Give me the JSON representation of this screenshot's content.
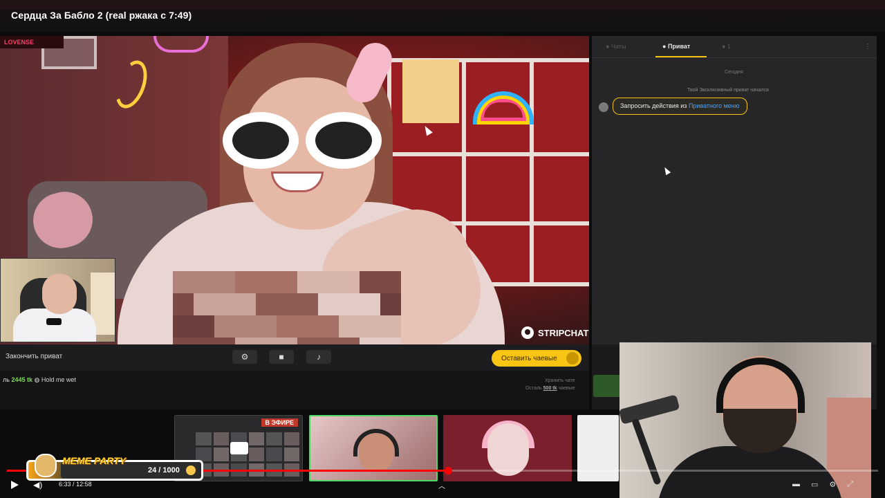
{
  "video": {
    "title": "Сердца За Бабло 2 (real ржака с 7:49)",
    "time_current": "6:33",
    "time_total": "12:58",
    "progress_fraction": 0.506
  },
  "stripchat": {
    "lovense_label": "LOVENSE",
    "watermark": "STRIPCHAT",
    "end_private_label": "Закончить приват",
    "tip_button_label": "Оставить чаевые",
    "tip_line": {
      "prefix": "ль",
      "amount": "2445 tk",
      "message": "Hold me wet"
    },
    "right_note_line1": "Хранить чате",
    "right_note_line2_prefix": "Осталь",
    "right_note_amount": "500 tk",
    "right_note_line2_suffix": "чаевые"
  },
  "chat": {
    "tab_left": "Чаты",
    "tab_active": "Приват",
    "tab_right": "1",
    "today_label": "Сегодня",
    "system_message": "Твой Эксклюзивный приват начался",
    "request_text": "Запросить действия из",
    "request_link": "Приватного меню"
  },
  "thumbnails": {
    "live_badge": "В ЭФИРЕ"
  },
  "meme_party": {
    "title": "MEME PARTY",
    "count": "24 / 1000"
  },
  "colors": {
    "accent_yellow": "#f9c514",
    "progress_red": "#ff0000",
    "tip_green": "#7ed957",
    "link_blue": "#4aa3ff"
  }
}
